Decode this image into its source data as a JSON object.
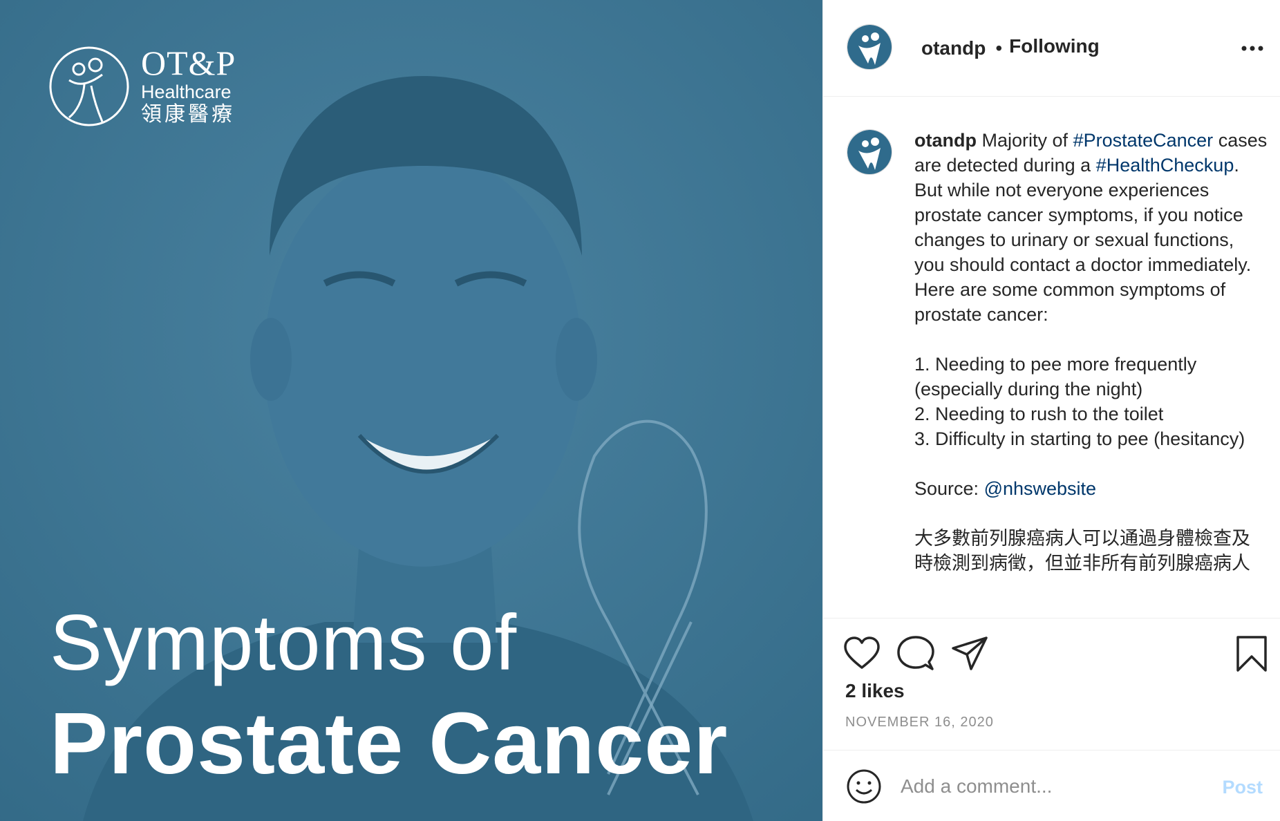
{
  "media": {
    "brand": {
      "name": "OT&P",
      "sub": "Healthcare",
      "zh": "領康醫療"
    },
    "headline_line1": "Symptoms of",
    "headline_line2": "Prostate Cancer",
    "background_color": "#3b7390"
  },
  "header": {
    "username": "otandp",
    "separator": "•",
    "follow_status": "Following",
    "more_icon": "more-horizontal-icon"
  },
  "caption": {
    "username": "otandp",
    "intro_1": "Majority of",
    "hashtag_1": "#ProstateCancer",
    "intro_2": "cases are detected during a",
    "hashtag_2": "#HealthCheckup",
    "intro_3": ". But while not everyone experiences prostate cancer symptoms, if you notice changes to urinary or sexual functions, you should contact a doctor immediately. Here are some common symptoms of prostate cancer:",
    "list": [
      "1. Needing to pee more frequently (especially during the night)",
      "2. Needing to rush to the toilet",
      "3. Difficulty in starting to pee (hesitancy)"
    ],
    "source_label": "Source:",
    "source_mention": "@nhswebsite",
    "zh_text": "大多數前列腺癌病人可以通過身體檢查及時檢測到病徵，但並非所有前列腺癌病人"
  },
  "actions": {
    "like_icon": "heart-icon",
    "comment_icon": "comment-icon",
    "share_icon": "share-icon",
    "save_icon": "bookmark-icon",
    "likes_text": "2 likes",
    "date_text": "NOVEMBER 16, 2020"
  },
  "comment": {
    "placeholder": "Add a comment...",
    "post_label": "Post",
    "emoji_icon": "emoji-icon"
  },
  "colors": {
    "hashtag": "#00376b",
    "post_button_disabled": "#b3dbff",
    "muted": "#8e8e8e"
  }
}
